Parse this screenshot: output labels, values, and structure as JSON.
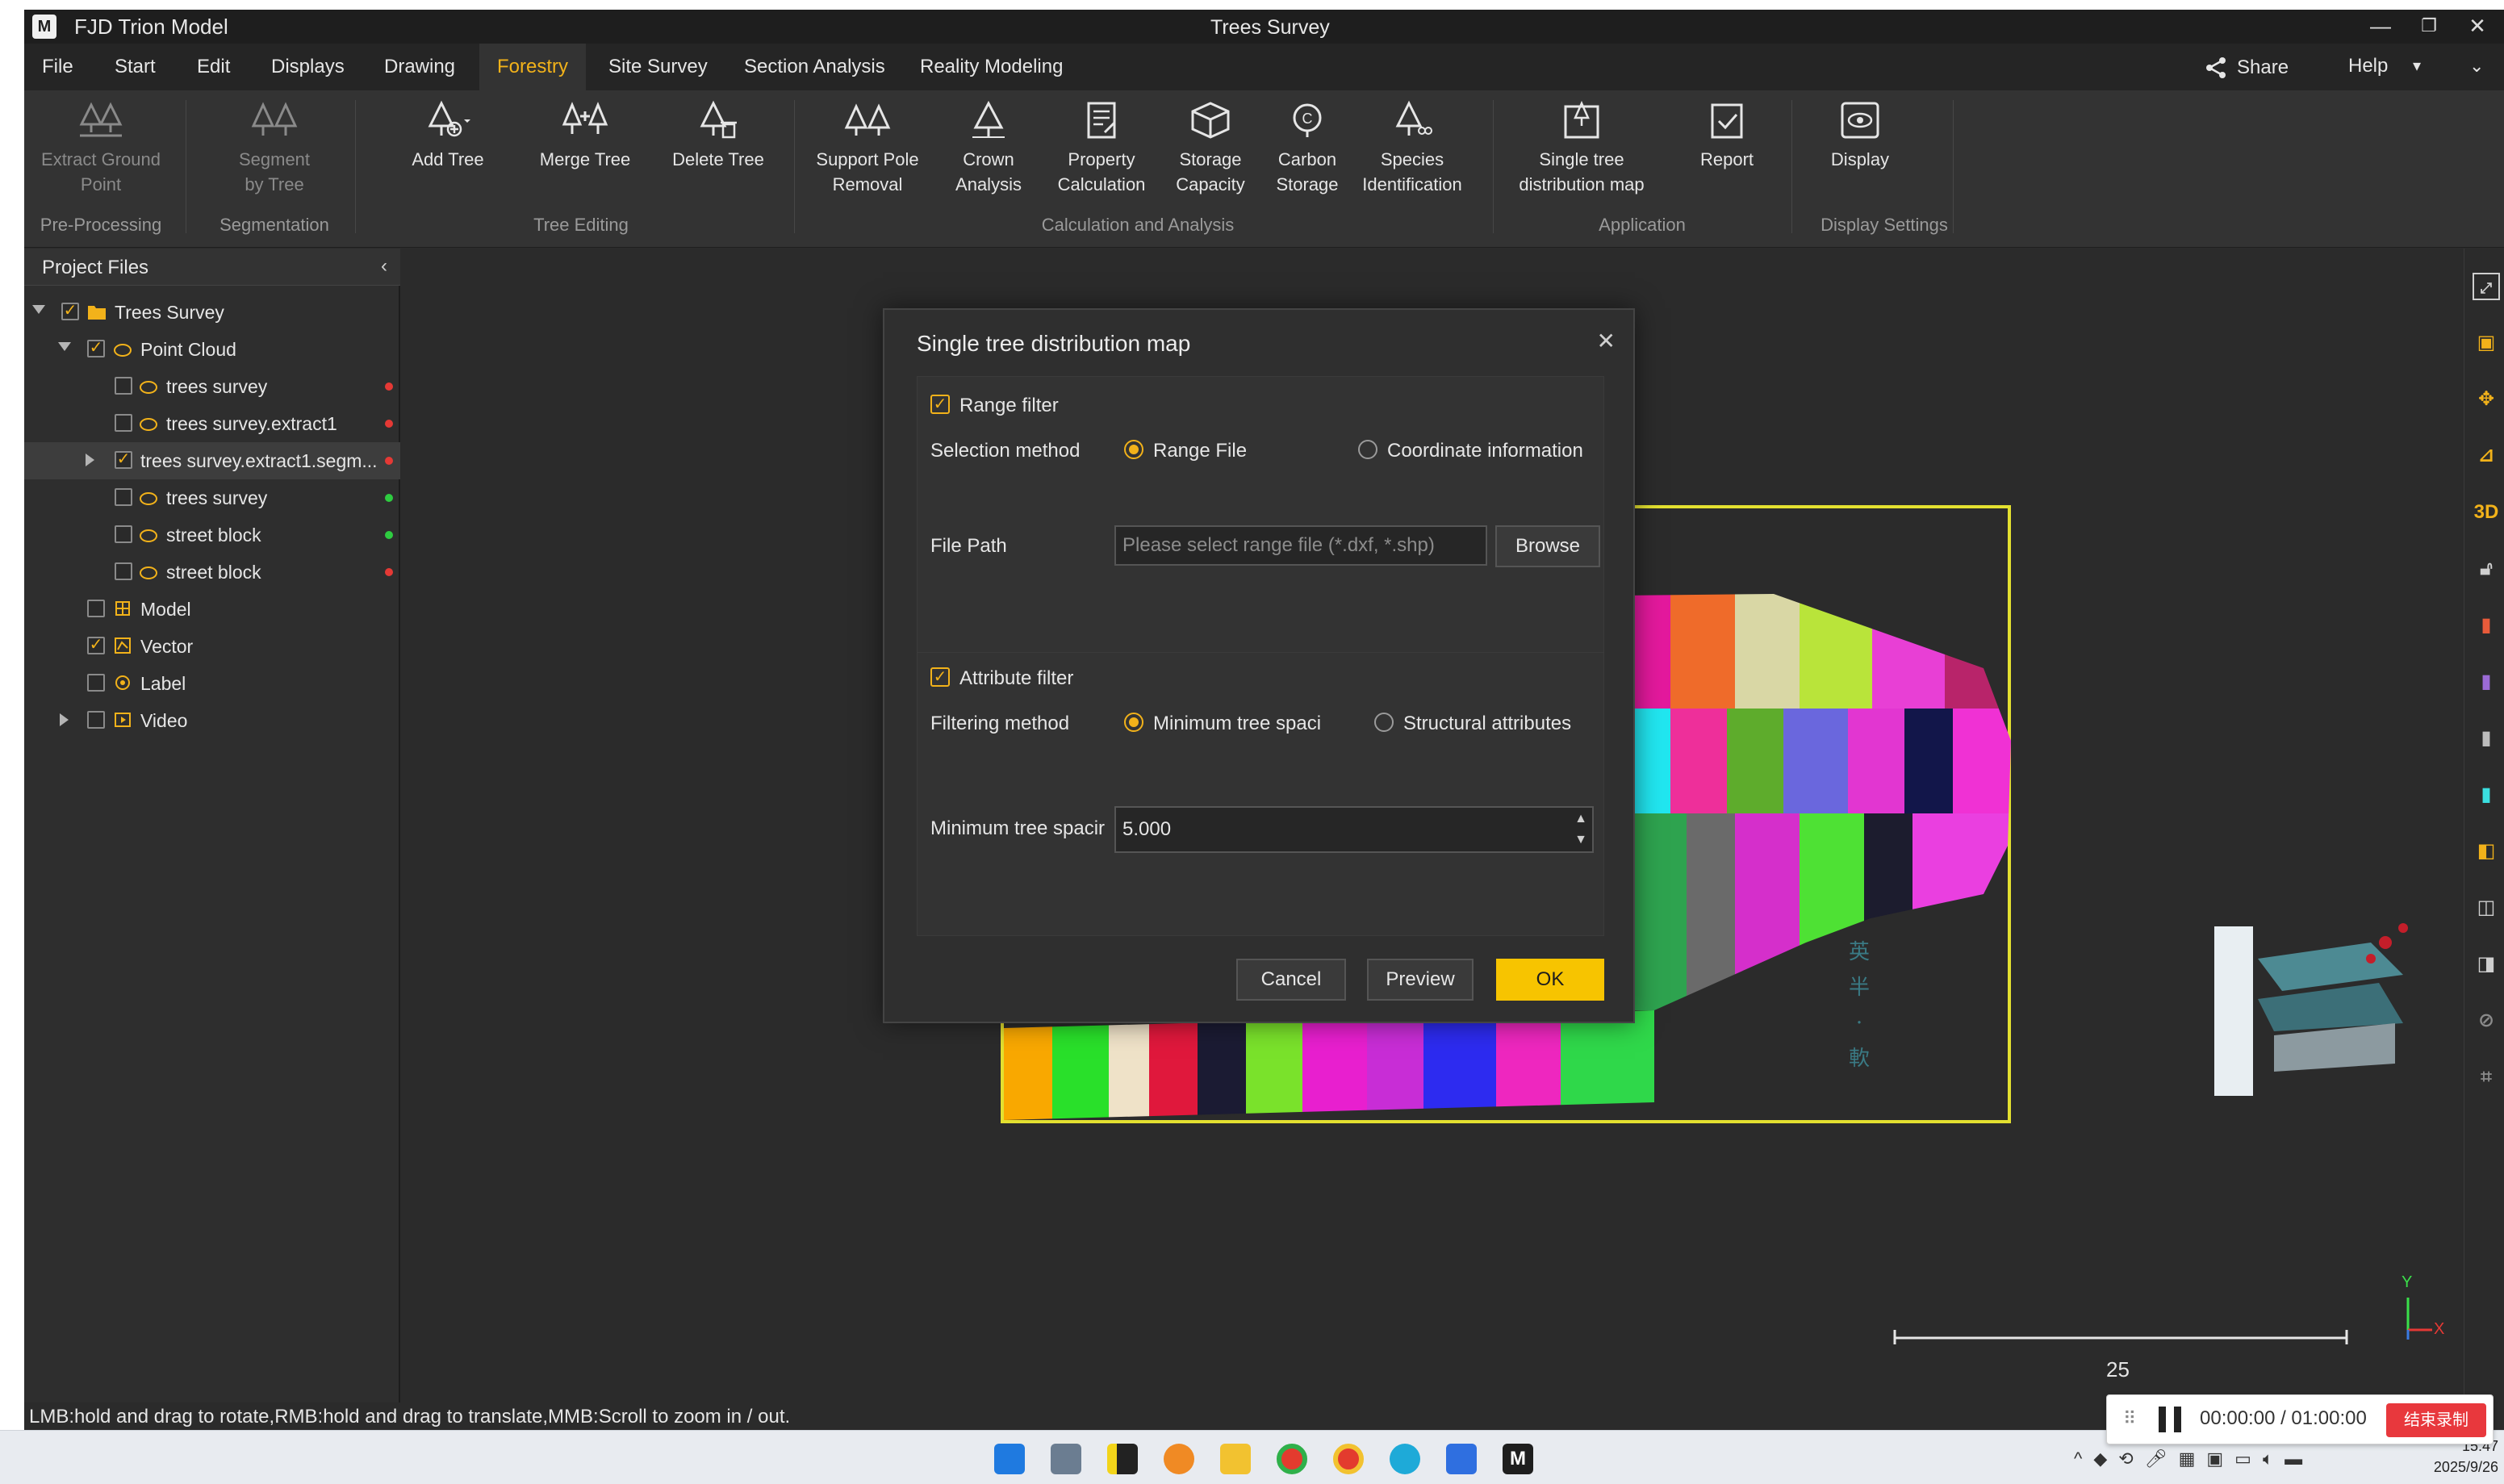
{
  "window": {
    "app_name": "FJD Trion Model",
    "doc_title": "Trees Survey",
    "minimize": "—",
    "restore": "❐",
    "close": "✕"
  },
  "menu": {
    "items": [
      "File",
      "Start",
      "Edit",
      "Displays",
      "Drawing",
      "Forestry",
      "Site Survey",
      "Section Analysis",
      "Reality Modeling"
    ],
    "active": "Forestry",
    "share": "Share",
    "help": "Help",
    "help_drop": "▾",
    "collapse": "⌄"
  },
  "ribbon": {
    "tools": {
      "extract_ground": [
        "Extract Ground",
        "Point"
      ],
      "segment": [
        "Segment",
        "by Tree"
      ],
      "add_tree": "Add Tree",
      "merge_tree": "Merge Tree",
      "delete_tree": "Delete Tree",
      "support_pole": [
        "Support Pole",
        "Removal"
      ],
      "crown": [
        "Crown",
        "Analysis"
      ],
      "property": [
        "Property",
        "Calculation"
      ],
      "storage": [
        "Storage",
        "Capacity"
      ],
      "carbon": [
        "Carbon",
        "Storage"
      ],
      "species": [
        "Species",
        "Identification"
      ],
      "single_tree": [
        "Single tree",
        "distribution map"
      ],
      "report": "Report",
      "display": "Display"
    },
    "groups": {
      "pre": "Pre-Processing",
      "seg": "Segmentation",
      "edit": "Tree Editing",
      "calc": "Calculation and Analysis",
      "app": "Application",
      "disp": "Display Settings"
    }
  },
  "panel": {
    "title": "Project Files",
    "collapse": "‹",
    "rows": [
      {
        "label": "Trees Survey",
        "checked": true
      },
      {
        "label": "Point Cloud",
        "checked": true
      },
      {
        "label": "trees survey",
        "checked": false
      },
      {
        "label": "trees survey.extract1",
        "checked": false
      },
      {
        "label": "trees survey.extract1.segm...",
        "checked": true
      },
      {
        "label": "trees  survey",
        "checked": false
      },
      {
        "label": "street block",
        "checked": false
      },
      {
        "label": "street block",
        "checked": false
      },
      {
        "label": "Model",
        "checked": false
      },
      {
        "label": "Vector",
        "checked": true
      },
      {
        "label": "Label",
        "checked": false
      },
      {
        "label": "Video",
        "checked": false
      }
    ],
    "status_colors": {
      "red": "#e53935",
      "green": "#2ecc40"
    }
  },
  "dialog": {
    "title": "Single tree distribution map",
    "close": "✕",
    "range_filter": "Range filter",
    "selection_method": "Selection method",
    "range_file": "Range File",
    "coordinate_info": "Coordinate information",
    "file_path": "File Path",
    "file_placeholder": "Please select range file (*.dxf, *.shp)",
    "browse": "Browse",
    "attribute_filter": "Attribute filter",
    "filtering_method": "Filtering method",
    "min_tree_spacing_opt": "Minimum tree spaci",
    "structural_attributes": "Structural attributes",
    "min_tree_spacing_label": "Minimum tree spacir",
    "min_tree_spacing_value": "5.000",
    "cancel": "Cancel",
    "preview": "Preview",
    "ok": "OK",
    "check_mark": "✓"
  },
  "viewport": {
    "scale_value": "25",
    "axis_y": "Y",
    "axis_x": "X",
    "right_icon_3d": "3D"
  },
  "status": {
    "hint": "LMB:hold and drag to rotate,RMB:hold and drag to translate,MMB:Scroll to zoom in / out."
  },
  "recorder": {
    "time": "00:00:00 / 01:00:00",
    "stop": "结束录制"
  },
  "taskbar": {
    "clock_time": "15:47",
    "clock_date": "2025/9/26"
  },
  "colors": {
    "accent": "#f2b21a",
    "ok_button": "#f7c400",
    "range_box": "#e3e030"
  }
}
